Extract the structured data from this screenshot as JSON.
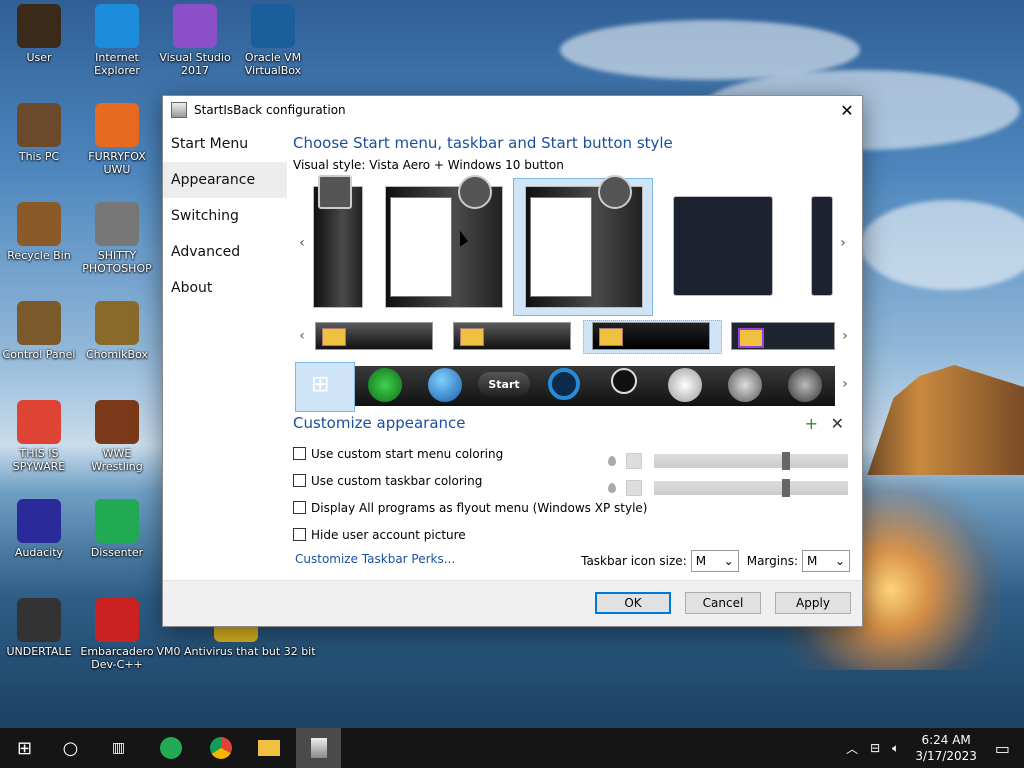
{
  "desktop": {
    "icons": [
      {
        "label": "User",
        "icon": "user-folder-icon",
        "color": "#3b2a1a"
      },
      {
        "label": "Internet Explorer",
        "icon": "edge-icon",
        "color": "#1d8ddb"
      },
      {
        "label": "Visual Studio 2017",
        "icon": "visual-studio-icon",
        "color": "#8a4fc9"
      },
      {
        "label": "Oracle VM VirtualBox",
        "icon": "virtualbox-icon",
        "color": "#1a5e9c"
      },
      {
        "label": "This PC",
        "icon": "computer-icon",
        "color": "#6a4a2a"
      },
      {
        "label": "FURRYFOX UWU",
        "icon": "firefox-icon",
        "color": "#e66a1f"
      },
      {
        "label": "Recycle Bin",
        "icon": "recycle-bin-icon",
        "color": "#8a5a2a"
      },
      {
        "label": "SHITTY PHOTOSHOP",
        "icon": "gimp-icon",
        "color": "#777777"
      },
      {
        "label": "Control Panel",
        "icon": "control-panel-icon",
        "color": "#7a5a2a"
      },
      {
        "label": "ChomikBox",
        "icon": "chomikbox-icon",
        "color": "#8a6a2a"
      },
      {
        "label": "THIS IS SPYWARE",
        "icon": "chrome-icon",
        "color": "#dd4433"
      },
      {
        "label": "WWE Wrestling",
        "icon": "game-icon",
        "color": "#7a3a1a"
      },
      {
        "label": "Audacity",
        "icon": "audacity-icon",
        "color": "#2a2a9a"
      },
      {
        "label": "Dissenter",
        "icon": "dissenter-icon",
        "color": "#22aa55"
      },
      {
        "label": "UNDERTALE",
        "icon": "unity-icon",
        "color": "#333333"
      },
      {
        "label": "Embarcadero Dev-C++",
        "icon": "devcpp-icon",
        "color": "#cc2222"
      },
      {
        "label": "VM0 Antivirus that but 32 bit",
        "icon": "antivirus-icon",
        "color": "#d9b020"
      }
    ]
  },
  "dialog": {
    "title": "StartIsBack configuration",
    "close_glyph": "✕",
    "sidebar": [
      {
        "label": "Start Menu",
        "active": false
      },
      {
        "label": "Appearance",
        "active": true
      },
      {
        "label": "Switching",
        "active": false
      },
      {
        "label": "Advanced",
        "active": false
      },
      {
        "label": "About",
        "active": false
      }
    ],
    "heading": "Choose Start menu, taskbar and Start button style",
    "visual_style_label": "Visual style:",
    "visual_style_value": "Vista Aero + Windows 10 button",
    "customize_heading": "Customize appearance",
    "add_glyph": "+",
    "remove_glyph": "✕",
    "options": [
      {
        "label": "Use custom start menu coloring",
        "checked": false
      },
      {
        "label": "Use custom taskbar coloring",
        "checked": false
      },
      {
        "label": "Display All programs as flyout menu (Windows XP style)",
        "checked": false
      },
      {
        "label": "Hide user account picture",
        "checked": false
      }
    ],
    "perks_link": "Customize Taskbar Perks...",
    "icon_size_label": "Taskbar icon size:",
    "icon_size_value": "M",
    "margins_label": "Margins:",
    "margins_value": "M",
    "buttons": {
      "ok": "OK",
      "cancel": "Cancel",
      "apply": "Apply"
    },
    "start_button_label": "Start",
    "accent": "#0078d7",
    "heading_color": "#1a4f9c"
  },
  "taskbar": {
    "time": "6:24 AM",
    "date": "3/17/2023"
  }
}
